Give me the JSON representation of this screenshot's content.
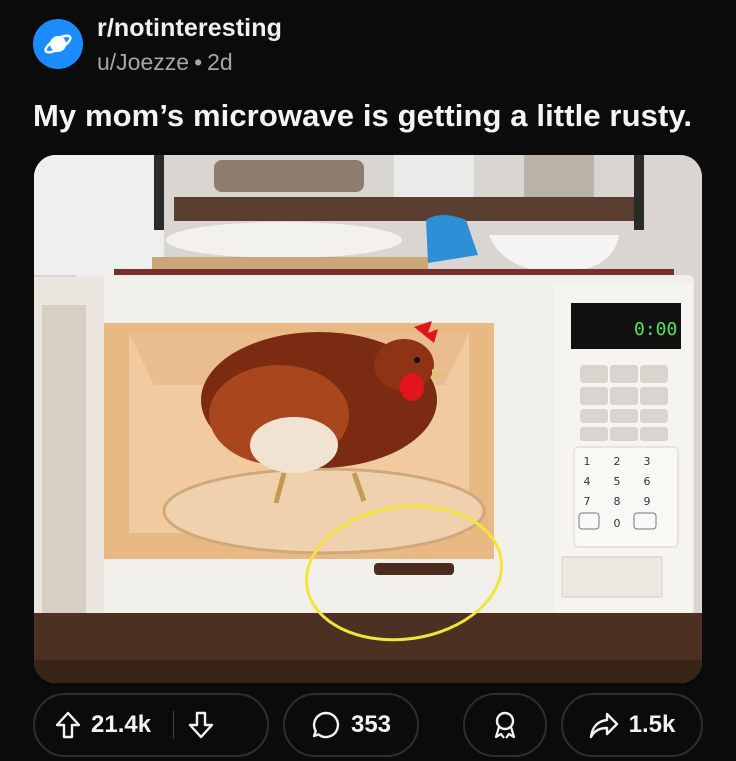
{
  "post": {
    "subreddit": "r/notinteresting",
    "author": "u/Joezze",
    "separator": "•",
    "age": "2d",
    "title": "My mom’s microwave is getting a little rusty."
  },
  "media": {
    "description_icon": "microwave-photo",
    "display_time": "0:00",
    "keypad_digits": [
      "1",
      "2",
      "3",
      "4",
      "5",
      "6",
      "7",
      "8",
      "9",
      "0"
    ],
    "highlight_color": "#f2e53a"
  },
  "actions": {
    "upvotes": "21.4k",
    "comments": "353",
    "shares": "1.5k"
  },
  "colors": {
    "background": "#0b0b0b",
    "avatar": "#1a8cff",
    "pill_border": "#2e2e2e"
  }
}
